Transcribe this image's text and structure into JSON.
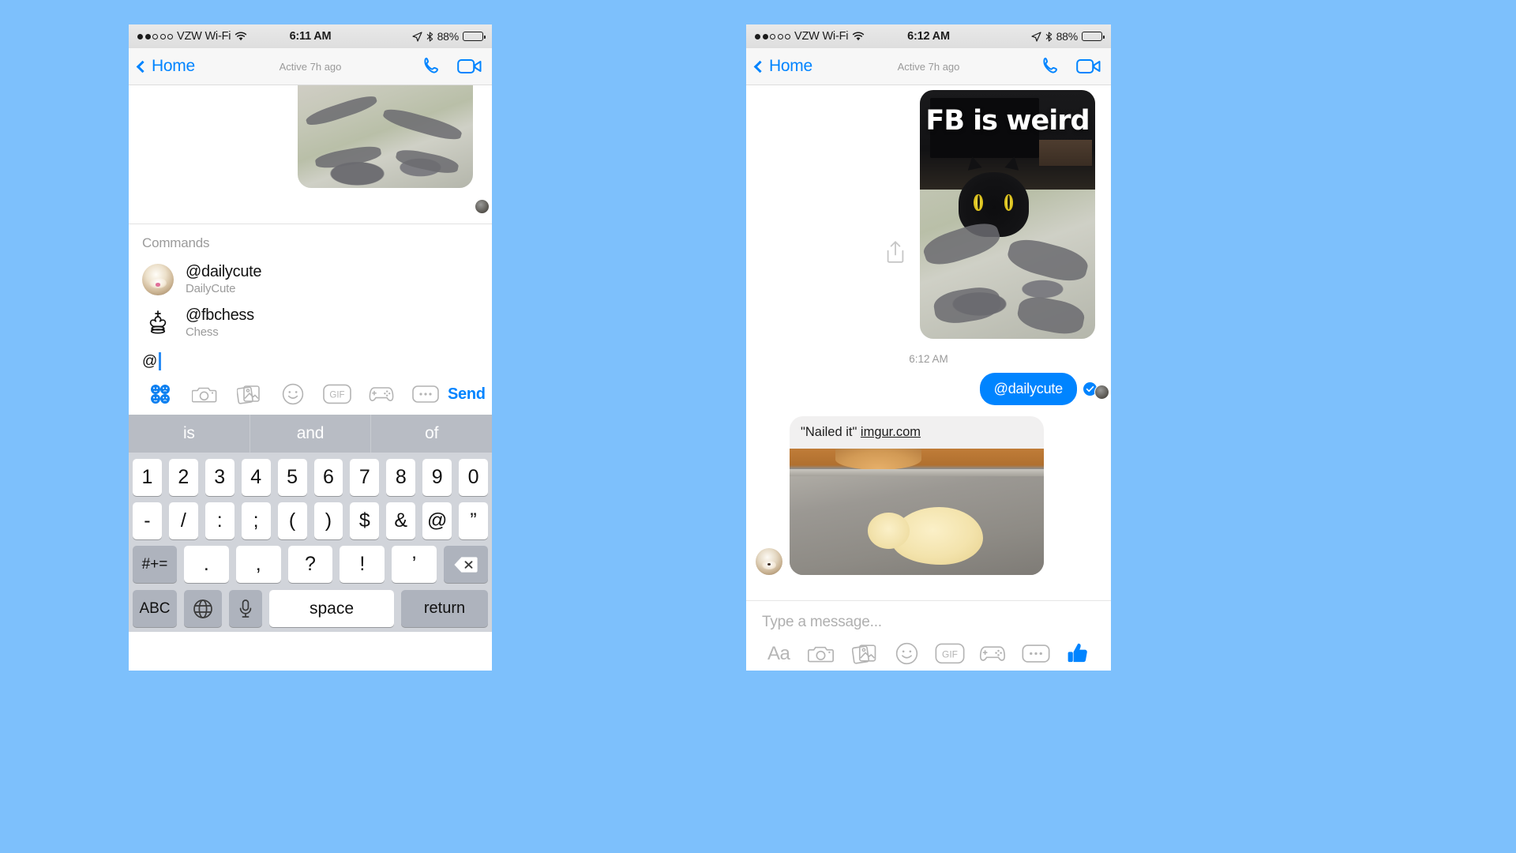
{
  "background_color": "#7dc0fc",
  "accent_color": "#0084ff",
  "phones": {
    "left": {
      "status_bar": {
        "signal_dots_filled": 2,
        "signal_dots_total": 5,
        "carrier": "VZW Wi-Fi",
        "wifi_icon": "wifi-icon",
        "time": "6:11 AM",
        "location_icon": "location-arrow-icon",
        "bluetooth_icon": "bluetooth-icon",
        "battery_percent": "88%",
        "battery_icon": "battery-icon"
      },
      "nav": {
        "back_icon": "chevron-left-icon",
        "back_label": "Home",
        "subtitle": "Active 7h ago",
        "call_icon": "phone-call-icon",
        "video_icon": "video-camera-icon"
      },
      "thread": {
        "photo_caption": "",
        "photo_alt": "cat-on-bed-photo"
      },
      "suggestions": {
        "title": "Commands",
        "items": [
          {
            "handle": "@dailycute",
            "description": "DailyCute",
            "avatar": "dog-avatar"
          },
          {
            "handle": "@fbchess",
            "description": "Chess",
            "avatar": "chess-king-icon"
          }
        ]
      },
      "composer": {
        "value": "@",
        "tools": [
          "apps-grid-icon",
          "camera-icon",
          "photos-icon",
          "sticker-smiley-icon",
          "gif-icon",
          "gamepad-icon",
          "more-dots-icon"
        ],
        "send_label": "Send"
      },
      "keyboard": {
        "predictions": [
          "is",
          "and",
          "of"
        ],
        "rows": [
          [
            "1",
            "2",
            "3",
            "4",
            "5",
            "6",
            "7",
            "8",
            "9",
            "0"
          ],
          [
            "-",
            "/",
            ":",
            ";",
            "(",
            ")",
            "$",
            "&",
            "@",
            "”"
          ],
          [
            "#+=",
            ".",
            ",",
            "?",
            "!",
            "’",
            "delete-icon"
          ],
          [
            "ABC",
            "globe-icon",
            "microphone-icon",
            "space",
            "return"
          ]
        ],
        "symbols_key": "#+=",
        "abc_key": "ABC",
        "space_key": "space",
        "return_key": "return",
        "delete_icon": "delete-backspace-icon",
        "globe_icon": "globe-icon",
        "mic_icon": "microphone-icon"
      }
    },
    "right": {
      "status_bar": {
        "signal_dots_filled": 2,
        "signal_dots_total": 5,
        "carrier": "VZW Wi-Fi",
        "wifi_icon": "wifi-icon",
        "time": "6:12 AM",
        "location_icon": "location-arrow-icon",
        "bluetooth_icon": "bluetooth-icon",
        "battery_percent": "88%",
        "battery_icon": "battery-icon"
      },
      "nav": {
        "back_icon": "chevron-left-icon",
        "back_label": "Home",
        "subtitle": "Active 7h ago",
        "call_icon": "phone-call-icon",
        "video_icon": "video-camera-icon"
      },
      "thread": {
        "photo_caption": "FB is weird",
        "share_icon": "share-upload-icon",
        "timestamp": "6:12 AM",
        "outgoing_message": "@dailycute",
        "seen_icon": "seen-check-icon",
        "link_card": {
          "quote": "\"Nailed it\"",
          "link_text": "imgur.com",
          "image_alt": "cookie-on-baking-sheet"
        }
      },
      "composer": {
        "placeholder": "Type a message...",
        "tools": [
          "text-format-icon",
          "camera-icon",
          "photos-icon",
          "sticker-smiley-icon",
          "gif-icon",
          "gamepad-icon",
          "more-dots-icon",
          "thumbs-up-icon"
        ],
        "format_label": "Aa",
        "gif_label": "GIF"
      }
    }
  }
}
